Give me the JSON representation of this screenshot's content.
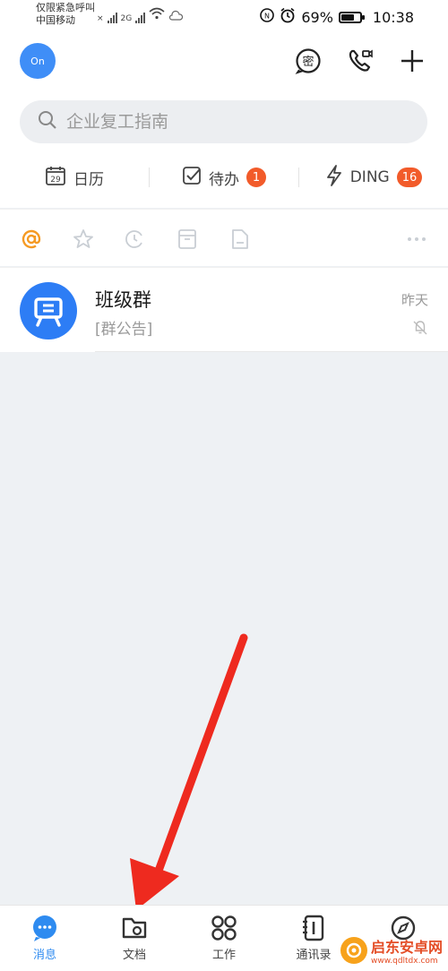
{
  "status_bar": {
    "line1": "仅限紧急呼叫",
    "line2": "中国移动",
    "signal_label": "2G",
    "battery": "69%",
    "time": "10:38"
  },
  "header": {
    "avatar_text": "On",
    "search_placeholder": "企业复工指南"
  },
  "quick_actions": [
    {
      "label": "日历",
      "icon": "calendar-icon",
      "calendar_day": "29"
    },
    {
      "label": "待办",
      "icon": "checkbox-icon",
      "badge": "1"
    },
    {
      "label": "DING",
      "icon": "lightning-icon",
      "badge": "16"
    }
  ],
  "filters": [
    "at-icon",
    "star-icon",
    "clock-icon",
    "archive-icon",
    "document-icon",
    "more-icon"
  ],
  "chats": [
    {
      "title": "班级群",
      "subtitle": "[群公告]",
      "time": "昨天",
      "muted": true
    }
  ],
  "bottom_nav": [
    {
      "label": "消息",
      "icon": "message-icon",
      "active": true
    },
    {
      "label": "文档",
      "icon": "folder-icon"
    },
    {
      "label": "工作",
      "icon": "grid-icon"
    },
    {
      "label": "通讯录",
      "icon": "contacts-icon"
    },
    {
      "label": "",
      "icon": "compass-icon"
    }
  ],
  "watermark": {
    "title": "启东安卓网",
    "url": "www.qdltdx.com"
  },
  "colors": {
    "accent": "#2e8bf0",
    "badge": "#f25b2a",
    "arrow": "#ee2a1f"
  }
}
